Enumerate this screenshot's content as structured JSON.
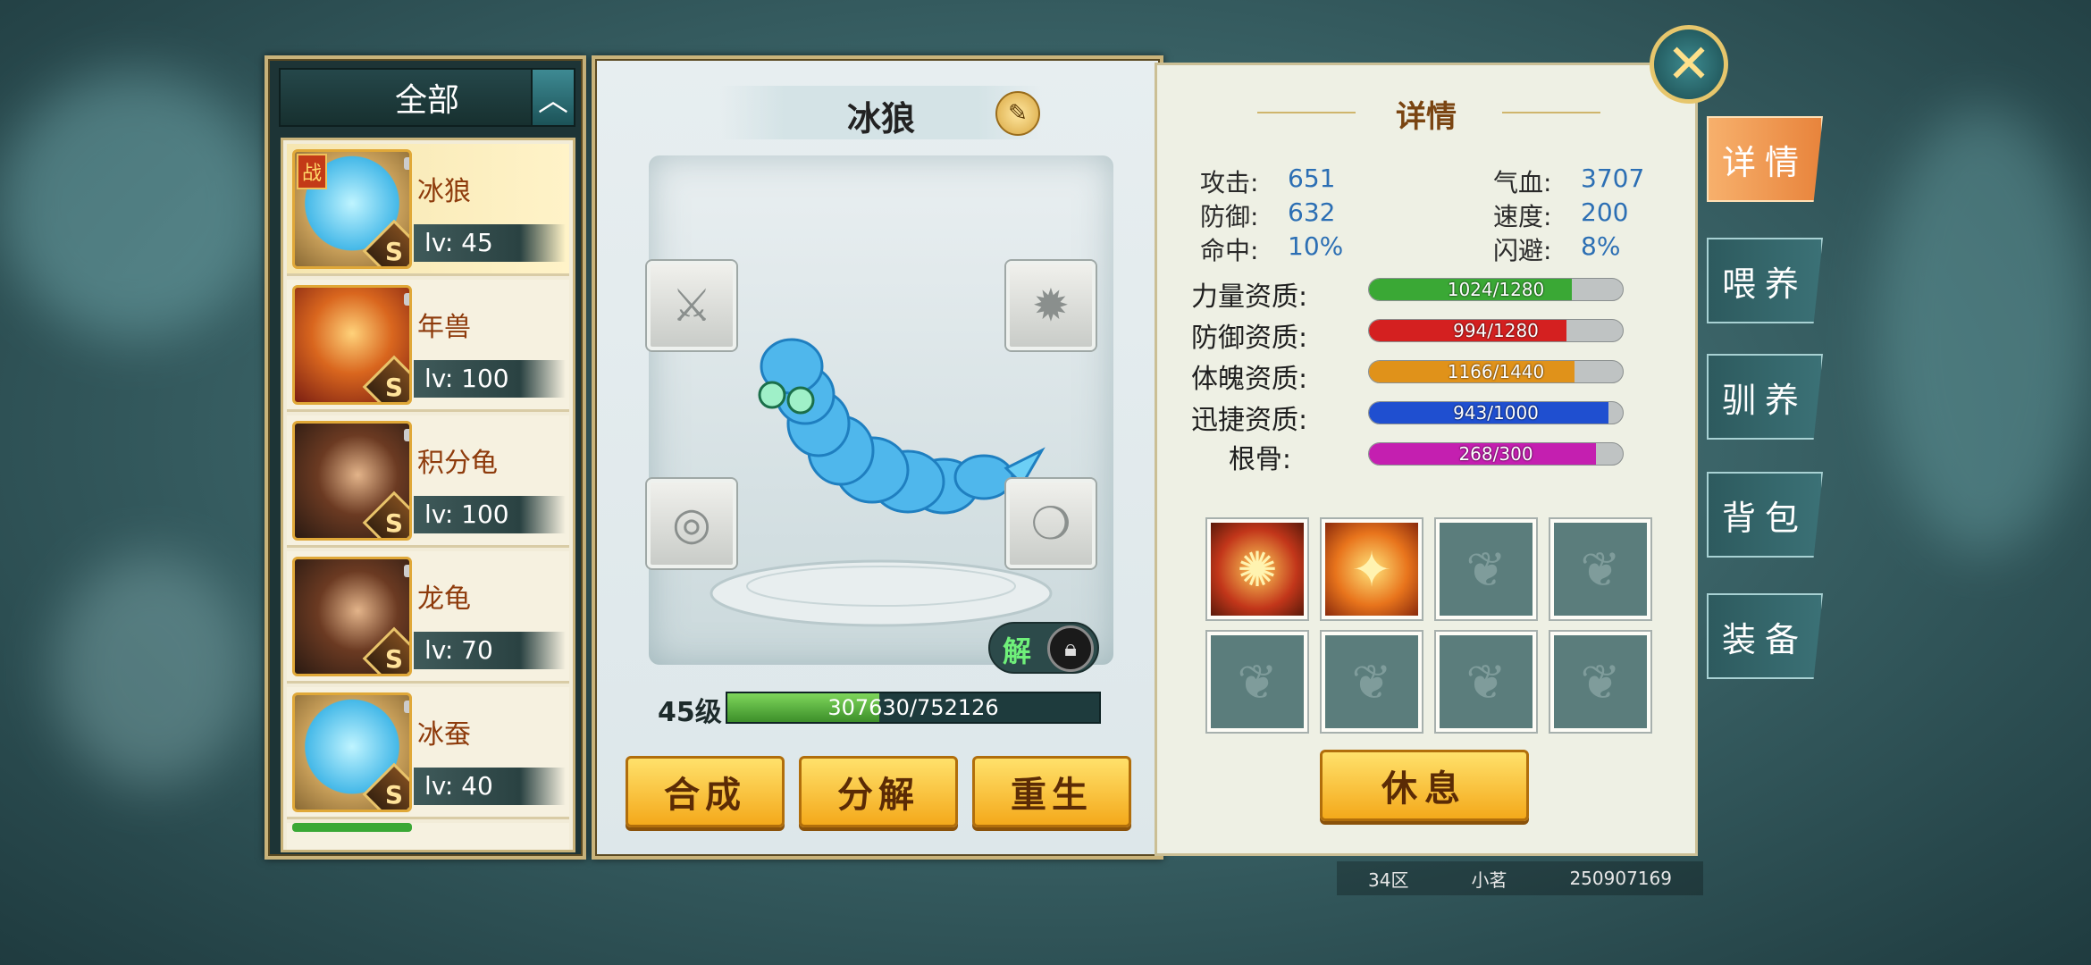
{
  "filter": {
    "label": "全部",
    "toggle_icon": "chevron-up-icon"
  },
  "pets": [
    {
      "name": "冰狼",
      "level": "lv: 45",
      "rank": "S",
      "battle_tag": "战",
      "selected": true
    },
    {
      "name": "年兽",
      "level": "lv: 100",
      "rank": "S"
    },
    {
      "name": "积分龟",
      "level": "lv: 100",
      "rank": "S"
    },
    {
      "name": "龙龟",
      "level": "lv: 70",
      "rank": "S"
    },
    {
      "name": "冰蚕",
      "level": "lv: 40",
      "rank": "S"
    }
  ],
  "pet_view": {
    "name": "冰狼",
    "unlock_label": "解",
    "level_label": "45级",
    "exp_text": "307630/752126",
    "exp_progress": 0.409
  },
  "actions": {
    "compose": "合成",
    "decompose": "分解",
    "rebirth": "重生"
  },
  "detail": {
    "title": "详情",
    "stats": [
      {
        "label": "攻击:",
        "value": "651"
      },
      {
        "label": "气血:",
        "value": "3707"
      },
      {
        "label": "防御:",
        "value": "632"
      },
      {
        "label": "速度:",
        "value": "200"
      },
      {
        "label": "命中:",
        "value": "10%"
      },
      {
        "label": "闪避:",
        "value": "8%"
      }
    ],
    "aptitudes": [
      {
        "label": "力量资质:",
        "text": "1024/1280",
        "ratio": 0.8,
        "color": "#3aa835"
      },
      {
        "label": "防御资质:",
        "text": "994/1280",
        "ratio": 0.777,
        "color": "#d42020"
      },
      {
        "label": "体魄资质:",
        "text": "1166/1440",
        "ratio": 0.81,
        "color": "#e0921a"
      },
      {
        "label": "迅捷资质:",
        "text": "943/1000",
        "ratio": 0.943,
        "color": "#1f4fd0"
      },
      {
        "label": "根骨:",
        "text": "268/300",
        "ratio": 0.893,
        "color": "#c41fb0"
      }
    ],
    "rest_button": "休息"
  },
  "side_tabs": [
    "详情",
    "喂养",
    "驯养",
    "背包",
    "装备"
  ],
  "footer": {
    "server": "34区",
    "player": "小茗",
    "id": "250907169"
  }
}
